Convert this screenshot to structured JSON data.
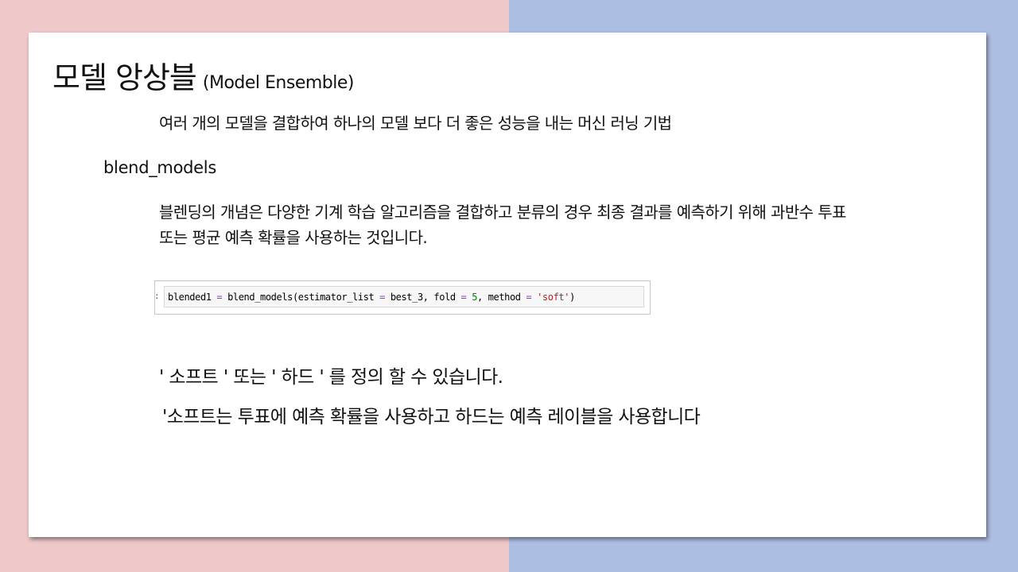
{
  "colors": {
    "background_left": "#efc9ca",
    "background_right": "#adbee3",
    "slide": "#ffffff",
    "code_operator": "#aa22ff",
    "code_number": "#008000",
    "code_string": "#ba2121"
  },
  "slide": {
    "title": "모델 앙상블",
    "subtitle": "(Model Ensemble)",
    "description": "여러 개의 모델을 결합하여 하나의 모델 보다 더 좋은 성능을 내는 머신 러닝 기법",
    "function_name": "blend_models",
    "paragraph": "블렌딩의 개념은 다양한 기계 학습 알고리즘을 결합하고 분류의 경우 최종 결과를 예측하기 위해 과반수 투표 또는 평균 예측 확률을 사용하는 것입니다.",
    "code_cell": {
      "prompt": ":",
      "tokens": [
        {
          "text": "blended1 ",
          "type": "name"
        },
        {
          "text": "=",
          "type": "op"
        },
        {
          "text": " blend_models(estimator_list ",
          "type": "name"
        },
        {
          "text": "=",
          "type": "op"
        },
        {
          "text": " best_3, fold ",
          "type": "name"
        },
        {
          "text": "=",
          "type": "op"
        },
        {
          "text": " ",
          "type": "name"
        },
        {
          "text": "5",
          "type": "num"
        },
        {
          "text": ", method ",
          "type": "name"
        },
        {
          "text": "=",
          "type": "op"
        },
        {
          "text": " ",
          "type": "name"
        },
        {
          "text": "'soft'",
          "type": "str"
        },
        {
          "text": ")",
          "type": "name"
        }
      ]
    },
    "note_1": "' 소프트 ' 또는 ' 하드 ' 를 정의 할 수 있습니다.",
    "note_2": "'소프트는 투표에 예측 확률을 사용하고 하드는 예측 레이블을 사용합니다"
  }
}
